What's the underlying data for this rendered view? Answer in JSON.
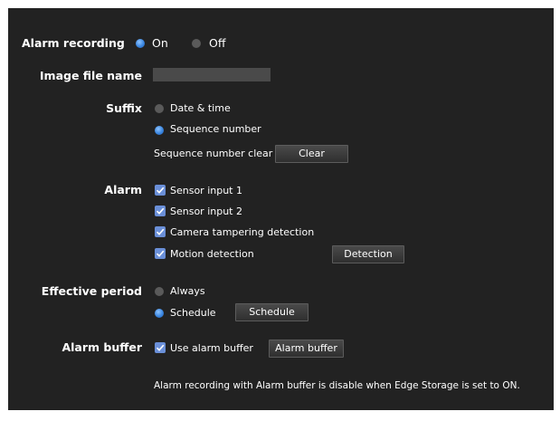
{
  "alarm_recording": {
    "label": "Alarm recording",
    "options": [
      "On",
      "Off"
    ],
    "selected": "On"
  },
  "image_file_name": {
    "label": "Image file name",
    "value": ""
  },
  "suffix": {
    "label": "Suffix",
    "options": [
      "Date & time",
      "Sequence number"
    ],
    "selected": "Sequence number",
    "sequence_clear_label": "Sequence number clear",
    "clear_button": "Clear"
  },
  "alarm": {
    "label": "Alarm",
    "items": [
      {
        "label": "Sensor input 1",
        "checked": true
      },
      {
        "label": "Sensor input 2",
        "checked": true
      },
      {
        "label": "Camera tampering detection",
        "checked": true
      },
      {
        "label": "Motion detection",
        "checked": true
      }
    ],
    "detection_button": "Detection"
  },
  "effective_period": {
    "label": "Effective period",
    "options": [
      "Always",
      "Schedule"
    ],
    "selected": "Schedule",
    "schedule_button": "Schedule"
  },
  "alarm_buffer": {
    "label": "Alarm buffer",
    "use_label": "Use alarm buffer",
    "checked": true,
    "button": "Alarm buffer"
  },
  "note": "Alarm recording with Alarm buffer is disable when Edge Storage is set to ON.",
  "colors": {
    "panel_bg": "#222222",
    "radio_selected": "#3a86e0",
    "checkbox": "#6a8fd8"
  }
}
